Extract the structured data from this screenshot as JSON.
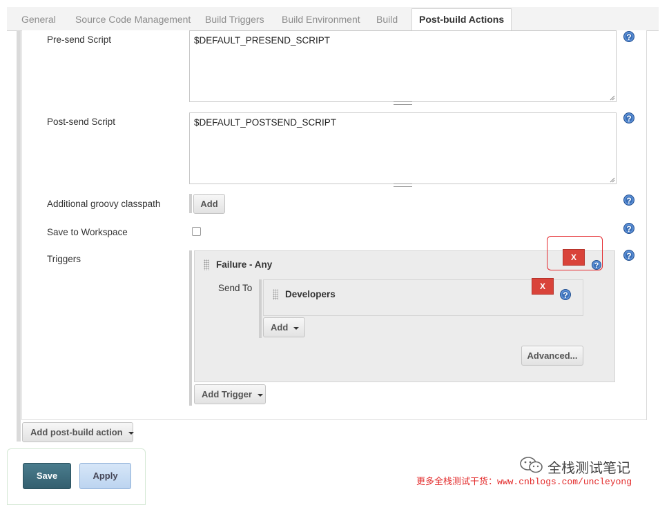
{
  "tabs": [
    {
      "label": "General",
      "active": false
    },
    {
      "label": "Source Code Management",
      "active": false
    },
    {
      "label": "Build Triggers",
      "active": false
    },
    {
      "label": "Build Environment",
      "active": false
    },
    {
      "label": "Build",
      "active": false
    },
    {
      "label": "Post-build Actions",
      "active": true
    }
  ],
  "form": {
    "presend_label": "Pre-send Script",
    "presend_value": "$DEFAULT_PRESEND_SCRIPT",
    "postsend_label": "Post-send Script",
    "postsend_value": "$DEFAULT_POSTSEND_SCRIPT",
    "classpath_label": "Additional groovy classpath",
    "classpath_add": "Add",
    "workspace_label": "Save to Workspace",
    "triggers_label": "Triggers"
  },
  "trigger": {
    "title": "Failure - Any",
    "remove_label": "X",
    "send_to_label": "Send To",
    "recipient": "Developers",
    "recipient_remove_label": "X",
    "add_label": "Add",
    "advanced_label": "Advanced..."
  },
  "buttons": {
    "add_trigger": "Add Trigger",
    "add_post_build": "Add post-build action",
    "save": "Save",
    "apply": "Apply"
  },
  "help_icon_glyph": "?",
  "watermark": {
    "brand": "全栈测试笔记",
    "promo": "更多全栈测试干货：www.cnblogs.com/uncleyong"
  },
  "colors": {
    "help_icon": "#3b6fb6",
    "remove_button": "#d9433a",
    "highlight_box": "#e4262b",
    "save_button": "#3f6f80",
    "apply_button": "#c9ddf4"
  }
}
